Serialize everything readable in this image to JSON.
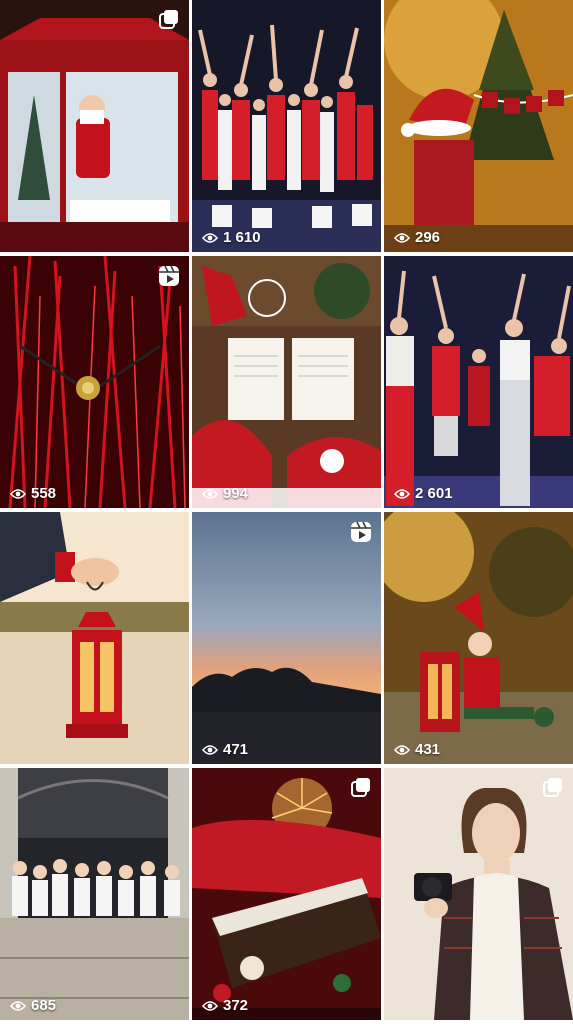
{
  "feed": {
    "tiles": [
      {
        "subject": "Red lantern with Santa figure inside",
        "type": "carousel",
        "views": ""
      },
      {
        "subject": "Dance troupe in red and white",
        "type": "none",
        "views": "1 610"
      },
      {
        "subject": "Child in Santa hat with Merry Christmas garland",
        "type": "none",
        "views": "296"
      },
      {
        "subject": "Red lit reeds with golden snitch",
        "type": "reel",
        "views": "558"
      },
      {
        "subject": "Letters to Santa flat lay",
        "type": "none",
        "views": "994"
      },
      {
        "subject": "Dancers in red costumes",
        "type": "none",
        "views": "2 601"
      },
      {
        "subject": "Hand holding red lantern by lake",
        "type": "none",
        "views": ""
      },
      {
        "subject": "Sunset sky over tree line",
        "type": "reel",
        "views": "471"
      },
      {
        "subject": "Elf figure next to red lantern",
        "type": "none",
        "views": "431"
      },
      {
        "subject": "Group of women on a balcony",
        "type": "none",
        "views": "685"
      },
      {
        "subject": "Christmas log cake with sparkler",
        "type": "carousel",
        "views": "372"
      },
      {
        "subject": "Woman holding camera",
        "type": "carousel",
        "views": ""
      }
    ]
  },
  "colors": {
    "overlay_text": "#ffffff",
    "background": "#ffffff"
  }
}
